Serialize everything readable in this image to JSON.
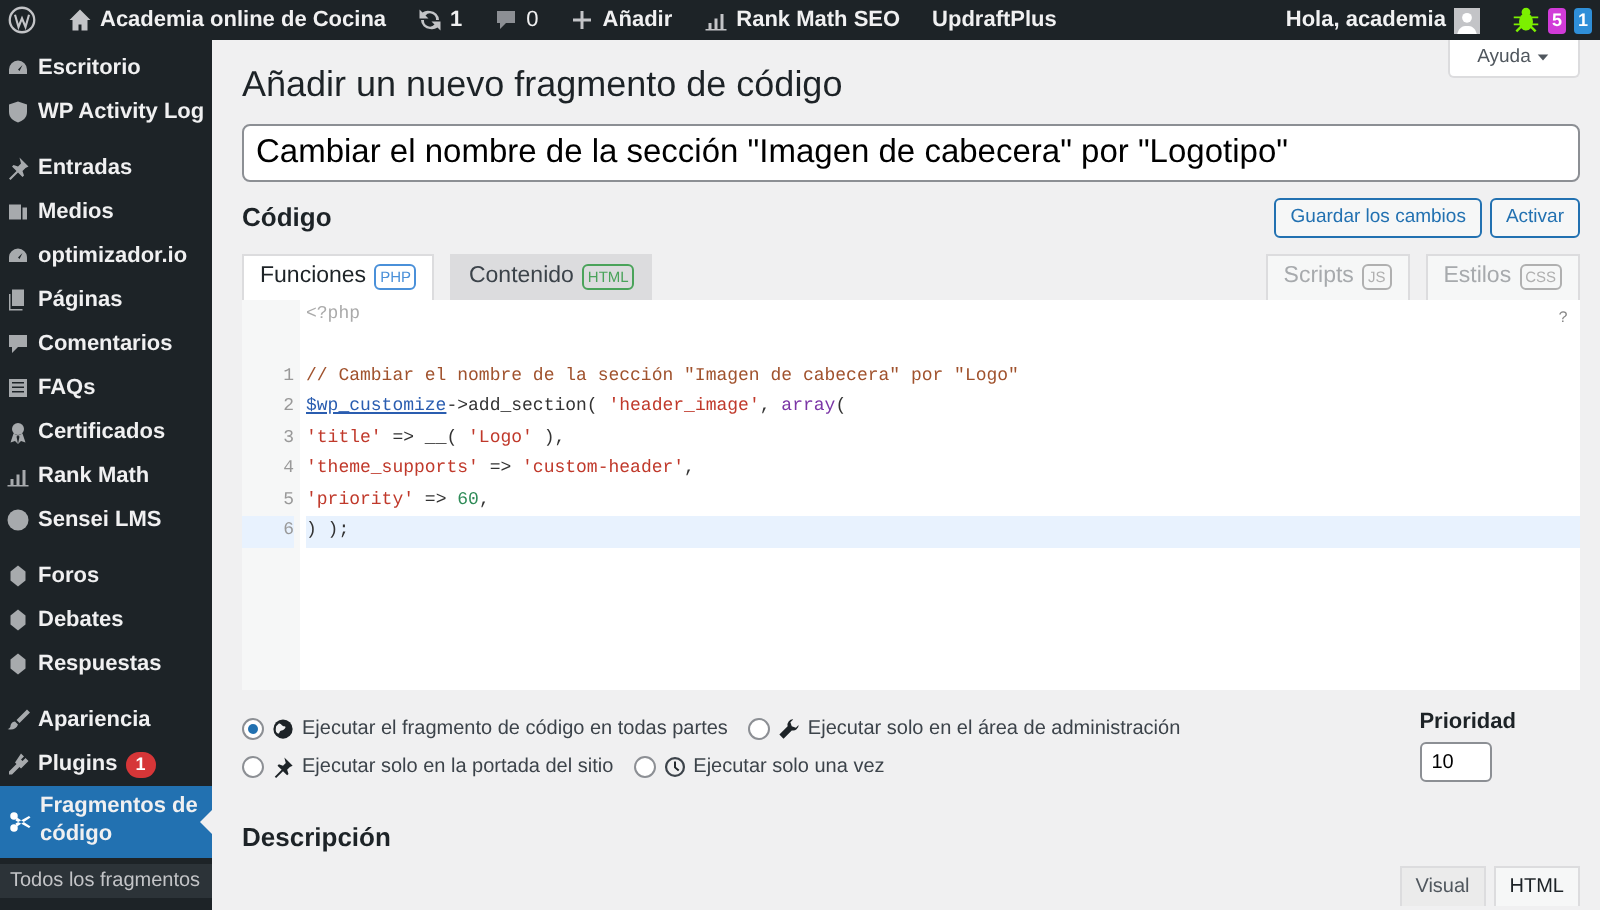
{
  "admin_bar": {
    "site": "Academia online de Cocina",
    "updates": "1",
    "comments": "0",
    "new": "Añadir",
    "seo": "Rank Math SEO",
    "backup": "UpdraftPlus",
    "greeting": "Hola, academia",
    "badges": [
      {
        "text": "5",
        "color": "#d13bd8"
      },
      {
        "text": "1",
        "color": "#2f8fd8"
      }
    ]
  },
  "sidebar": {
    "groups": [
      {
        "items": [
          {
            "label": "Escritorio",
            "selected": false
          },
          {
            "label": "WP Activity Log",
            "selected": false
          }
        ]
      },
      {
        "items": [
          {
            "label": "Entradas",
            "selected": false
          },
          {
            "label": "Medios",
            "selected": false
          },
          {
            "label": "optimizador.io",
            "selected": false
          },
          {
            "label": "Páginas",
            "selected": false
          },
          {
            "label": "Comentarios",
            "selected": false
          },
          {
            "label": "FAQs",
            "selected": false
          },
          {
            "label": "Certificados",
            "selected": false
          },
          {
            "label": "Rank Math",
            "selected": false
          },
          {
            "label": "Sensei LMS",
            "selected": false
          }
        ]
      },
      {
        "items": [
          {
            "label": "Foros",
            "selected": false
          },
          {
            "label": "Debates",
            "selected": false
          },
          {
            "label": "Respuestas",
            "selected": false
          }
        ]
      },
      {
        "items": [
          {
            "label": "Apariencia",
            "selected": false
          },
          {
            "label": "Plugins",
            "selected": false,
            "count": "1"
          },
          {
            "label": "Fragmentos de código",
            "selected": true
          }
        ]
      }
    ],
    "submenu": [
      "Todos los fragmentos"
    ]
  },
  "help_button": "Ayuda",
  "page_title": "Añadir un nuevo fragmento de código",
  "snippet_title": "Cambiar el nombre de la sección \"Imagen de cabecera\" por \"Logotipo\"",
  "code_heading": "Código",
  "actions": [
    "Guardar los cambios",
    "Activar"
  ],
  "tabs": [
    {
      "label": "Funciones",
      "badge": "PHP",
      "color": "#4a90d9",
      "selected": true,
      "disabled": false
    },
    {
      "label": "Contenido",
      "badge": "HTML",
      "color": "#4aa35a",
      "selected": false,
      "disabled": false
    },
    {
      "label": "Scripts",
      "badge": "JS",
      "color": "#b0b0b0",
      "selected": false,
      "disabled": true
    },
    {
      "label": "Estilos",
      "badge": "CSS",
      "color": "#b0b0b0",
      "selected": false,
      "disabled": true
    }
  ],
  "editor": {
    "prefix": "<?php",
    "help": "?",
    "lines": [
      {
        "number": "1",
        "active": false,
        "tokens": [
          {
            "text": "// Cambiar el nombre de la sección \"Imagen de cabecera\" por \"Logo\"",
            "kind": "comment"
          }
        ]
      },
      {
        "number": "2",
        "active": false,
        "tokens": [
          {
            "text": "$wp_customize",
            "kind": "variable"
          },
          {
            "text": "->add_section( ",
            "kind": "plain"
          },
          {
            "text": "'header_image'",
            "kind": "string"
          },
          {
            "text": ", ",
            "kind": "plain"
          },
          {
            "text": "array",
            "kind": "keyword"
          },
          {
            "text": "(",
            "kind": "plain"
          }
        ]
      },
      {
        "number": "3",
        "active": false,
        "tokens": [
          {
            "text": "'title'",
            "kind": "string"
          },
          {
            "text": " => __( ",
            "kind": "plain"
          },
          {
            "text": "'Logo'",
            "kind": "string"
          },
          {
            "text": " ),",
            "kind": "plain"
          }
        ]
      },
      {
        "number": "4",
        "active": false,
        "tokens": [
          {
            "text": "'theme_supports'",
            "kind": "string"
          },
          {
            "text": " => ",
            "kind": "plain"
          },
          {
            "text": "'custom-header'",
            "kind": "string"
          },
          {
            "text": ",",
            "kind": "plain"
          }
        ]
      },
      {
        "number": "5",
        "active": false,
        "tokens": [
          {
            "text": "'priority'",
            "kind": "string"
          },
          {
            "text": " => ",
            "kind": "plain"
          },
          {
            "text": "60",
            "kind": "number"
          },
          {
            "text": ",",
            "kind": "plain"
          }
        ]
      },
      {
        "number": "6",
        "active": true,
        "tokens": [
          {
            "text": ") );",
            "kind": "plain"
          }
        ]
      }
    ]
  },
  "scope_options": [
    {
      "label": "Ejecutar el fragmento de código en todas partes",
      "selected": true
    },
    {
      "label": "Ejecutar solo en el área de administración",
      "selected": false
    },
    {
      "label": "Ejecutar solo en la portada del sitio",
      "selected": false
    },
    {
      "label": "Ejecutar solo una vez",
      "selected": false
    }
  ],
  "priority": {
    "label": "Prioridad",
    "value": "10"
  },
  "description_heading": "Descripción",
  "editor_modes": [
    {
      "label": "Visual",
      "selected": false
    },
    {
      "label": "HTML",
      "selected": true
    }
  ]
}
